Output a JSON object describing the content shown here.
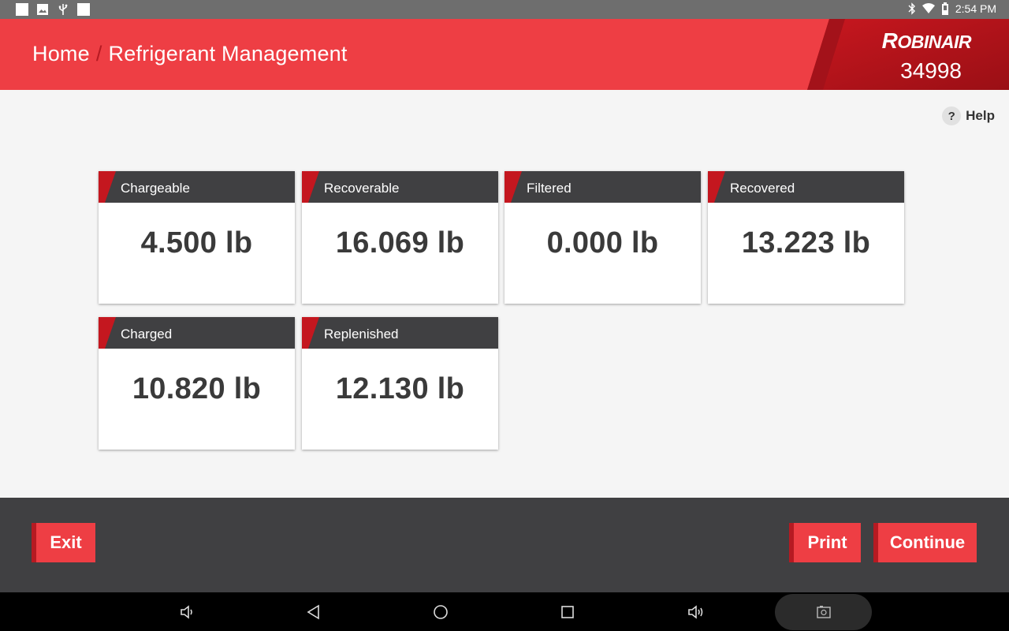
{
  "status_bar": {
    "time": "2:54 PM",
    "icons": [
      "notification-square-icon",
      "image-icon",
      "usb-icon",
      "notification-square-icon",
      "bluetooth-icon",
      "wifi-icon",
      "battery-icon"
    ]
  },
  "header": {
    "breadcrumb_home": "Home",
    "breadcrumb_separator": "/",
    "breadcrumb_current": "Refrigerant Management",
    "brand_initial": "R",
    "brand_rest": "OBINAIR",
    "model": "34998"
  },
  "help": {
    "icon_glyph": "?",
    "label": "Help"
  },
  "cards": [
    {
      "title": "Chargeable",
      "value": "4.500 lb"
    },
    {
      "title": "Recoverable",
      "value": "16.069 lb"
    },
    {
      "title": "Filtered",
      "value": "0.000 lb"
    },
    {
      "title": "Recovered",
      "value": "13.223 lb"
    },
    {
      "title": "Charged",
      "value": "10.820 lb"
    },
    {
      "title": "Replenished",
      "value": "12.130 lb"
    }
  ],
  "footer": {
    "exit_label": "Exit",
    "print_label": "Print",
    "continue_label": "Continue"
  },
  "nav_bar": {
    "icons": [
      "volume-down-icon",
      "back-icon",
      "home-icon",
      "recents-icon",
      "volume-up-icon",
      "screenshot-icon"
    ]
  },
  "colors": {
    "brand_red": "#ee3e44",
    "dark_red": "#b61a22",
    "dark_gray": "#404042"
  }
}
